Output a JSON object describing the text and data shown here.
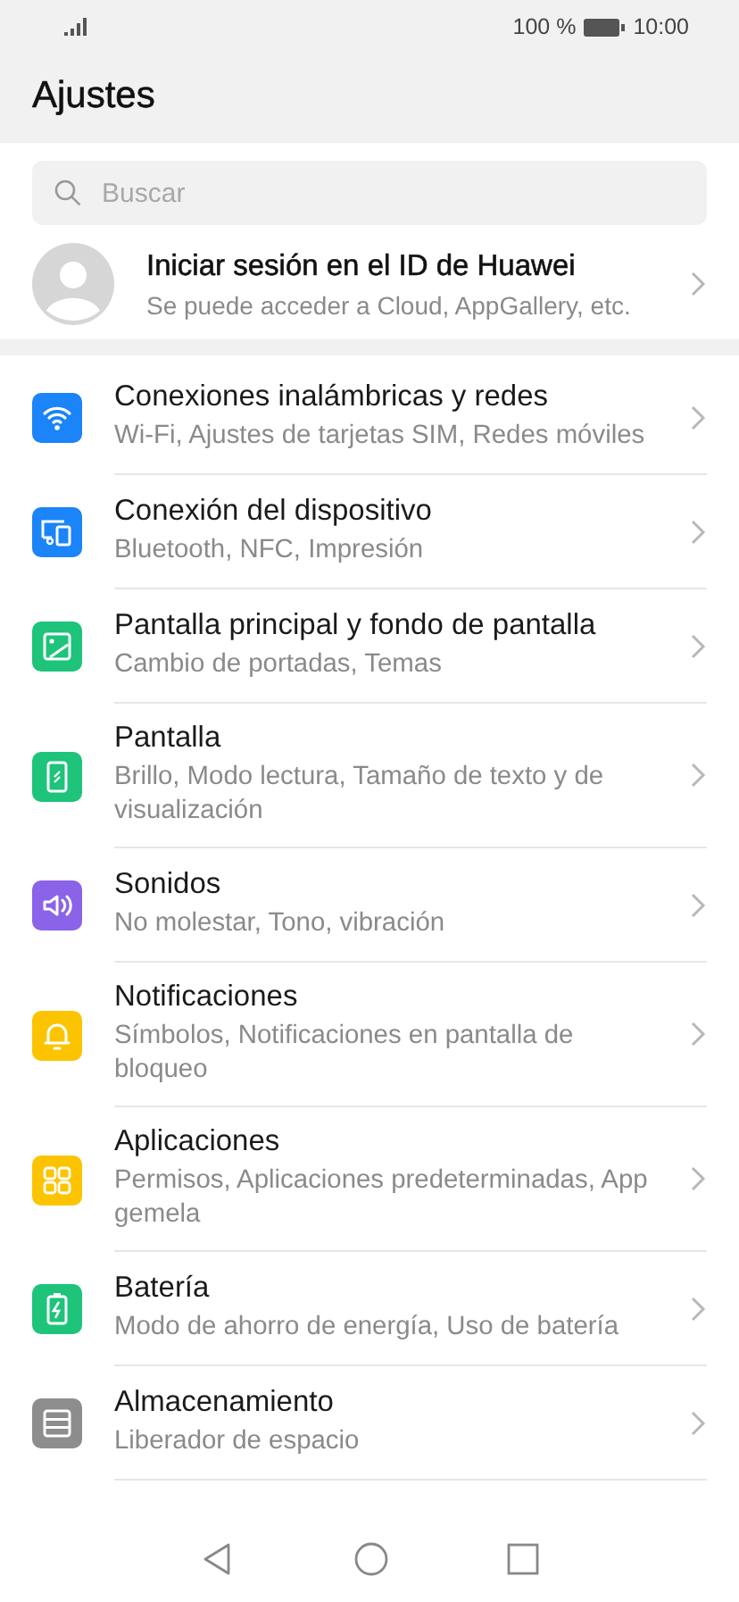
{
  "status_bar": {
    "battery_text": "100 %",
    "time": "10:00"
  },
  "title": "Ajustes",
  "search": {
    "placeholder": "Buscar"
  },
  "account": {
    "title": "Iniciar sesión en el ID de Huawei",
    "subtitle": "Se puede acceder a Cloud, AppGallery, etc."
  },
  "items": [
    {
      "kind": "wifi",
      "color": "#1a84f8",
      "title": "Conexiones inalámbricas y redes",
      "subtitle": "Wi-Fi, Ajustes de tarjetas SIM, Redes móviles"
    },
    {
      "kind": "devices",
      "color": "#1a84f8",
      "title": "Conexión del dispositivo",
      "subtitle": "Bluetooth, NFC, Impresión"
    },
    {
      "kind": "image",
      "color": "#1dc47a",
      "title": "Pantalla principal y fondo de pantalla",
      "subtitle": "Cambio de portadas, Temas"
    },
    {
      "kind": "phone",
      "color": "#1dc47a",
      "title": "Pantalla",
      "subtitle": "Brillo, Modo lectura, Tamaño de texto y de visualización"
    },
    {
      "kind": "sound",
      "color": "#8a63e8",
      "title": "Sonidos",
      "subtitle": "No molestar, Tono, vibración"
    },
    {
      "kind": "bell",
      "color": "#fcc400",
      "title": "Notificaciones",
      "subtitle": "Símbolos, Notificaciones en pantalla de bloqueo"
    },
    {
      "kind": "grid",
      "color": "#fcc400",
      "title": "Aplicaciones",
      "subtitle": "Permisos, Aplicaciones predeterminadas, App gemela"
    },
    {
      "kind": "battery",
      "color": "#1dc47a",
      "title": "Batería",
      "subtitle": "Modo de ahorro de energía, Uso de batería"
    },
    {
      "kind": "storage",
      "color": "#8d8d8d",
      "title": "Almacenamiento",
      "subtitle": "Liberador de espacio"
    }
  ]
}
